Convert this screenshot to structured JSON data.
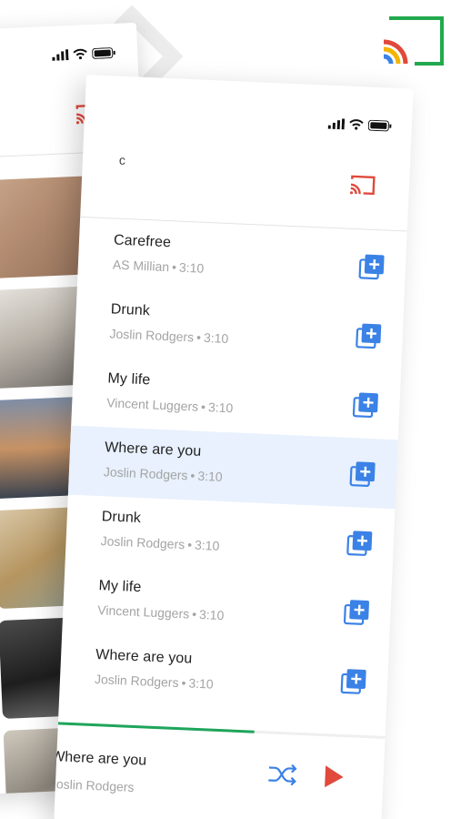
{
  "colors": {
    "accent_blue": "#3b82e6",
    "cast_red": "#e0493b",
    "progress_green": "#1fa55b",
    "active_row": "#e8f1fd"
  },
  "icons": {
    "status_signal": "signal-icon",
    "status_wifi": "wifi-icon",
    "status_battery": "battery-icon",
    "cast": "cast-icon",
    "add_to_queue": "add-to-queue-icon",
    "shuffle": "shuffle-icon",
    "play": "play-icon"
  },
  "front": {
    "header_letter": "c",
    "songs": [
      {
        "title": "Carefree",
        "artist": "AS Millian",
        "duration": "3:10"
      },
      {
        "title": "Drunk",
        "artist": "Joslin Rodgers",
        "duration": "3:10"
      },
      {
        "title": "My life",
        "artist": "Vincent Luggers",
        "duration": "3:10"
      },
      {
        "title": "Where are you",
        "artist": "Joslin Rodgers",
        "duration": "3:10",
        "active": true
      },
      {
        "title": "Drunk",
        "artist": "Joslin Rodgers",
        "duration": "3:10"
      },
      {
        "title": "My life",
        "artist": "Vincent Luggers",
        "duration": "3:10"
      },
      {
        "title": "Where are you",
        "artist": "Joslin Rodgers",
        "duration": "3:10"
      }
    ],
    "separator": "•",
    "now_playing": {
      "title": "Where are you",
      "artist": "Joslin Rodgers",
      "progress": 0.6
    }
  }
}
